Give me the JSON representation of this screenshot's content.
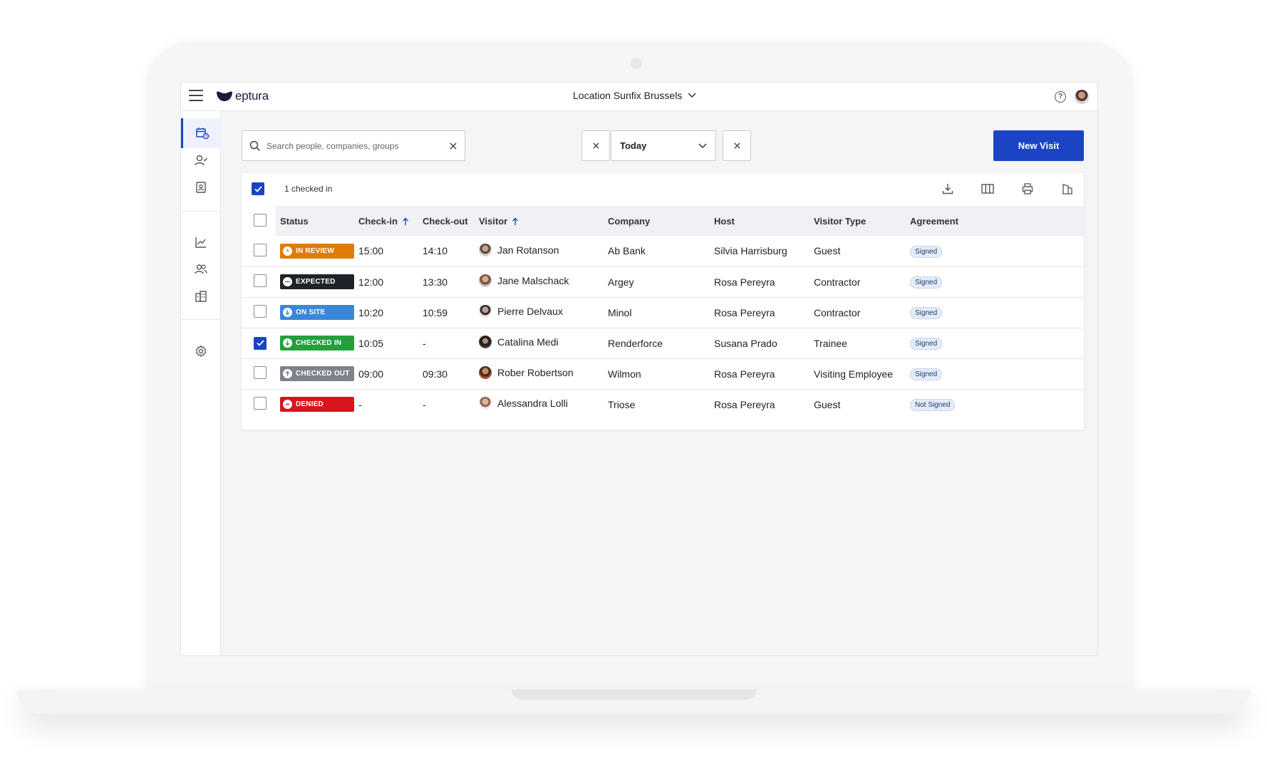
{
  "app": {
    "logo_text": "eptura",
    "location": "Location Sunfix Brussels"
  },
  "sidebar": {
    "items": [
      "calendar-visits",
      "user-check",
      "contact-card",
      "analytics",
      "people",
      "buildings",
      "settings"
    ]
  },
  "toolbar": {
    "search_placeholder": "Search people, companies, groups",
    "date_value": "Today",
    "new_visit_label": "New Visit"
  },
  "selection": {
    "label": "1 checked in"
  },
  "table": {
    "headers": [
      "Status",
      "Check-in",
      "Check-out",
      "Visitor",
      "Company",
      "Host",
      "Visitor Type",
      "Agreement"
    ],
    "rows": [
      {
        "status": "IN REVIEW",
        "checkin": "15:00",
        "checkout": "14:10",
        "visitor": "Jan Rotanson",
        "company": "Ab Bank",
        "host": "Silvia Harrisburg",
        "type": "Guest",
        "agreement": "Signed",
        "checked": false
      },
      {
        "status": "EXPECTED",
        "checkin": "12:00",
        "checkout": "13:30",
        "visitor": "Jane Malschack",
        "company": "Argey",
        "host": "Rosa Pereyra",
        "type": "Contractor",
        "agreement": "Signed",
        "checked": false
      },
      {
        "status": "ON SITE",
        "checkin": "10:20",
        "checkout": "10:59",
        "visitor": "Pierre Delvaux",
        "company": "Minol",
        "host": "Rosa Pereyra",
        "type": "Contractor",
        "agreement": "Signed",
        "checked": false
      },
      {
        "status": "CHECKED IN",
        "checkin": "10:05",
        "checkout": "-",
        "visitor": "Catalina Medi",
        "company": "Renderforce",
        "host": "Susana Prado",
        "type": "Trainee",
        "agreement": "Signed",
        "checked": true
      },
      {
        "status": "CHECKED OUT",
        "checkin": "09:00",
        "checkout": "09:30",
        "visitor": "Rober Robertson",
        "company": "Wilmon",
        "host": "Rosa Pereyra",
        "type": "Visiting Employee",
        "agreement": "Signed",
        "checked": false
      },
      {
        "status": "DENIED",
        "checkin": "-",
        "checkout": "-",
        "visitor": "Alessandra Lolli",
        "company": "Triose",
        "host": "Rosa Pereyra",
        "type": "Guest",
        "agreement": "Not Signed",
        "checked": false
      }
    ]
  },
  "colors": {
    "primary": "#1a44c4",
    "in_review": "#e07b00",
    "expected": "#1e2329",
    "on_site": "#3b87d6",
    "checked_in": "#23a03c",
    "checked_out": "#7d828b",
    "denied": "#d9141c"
  }
}
